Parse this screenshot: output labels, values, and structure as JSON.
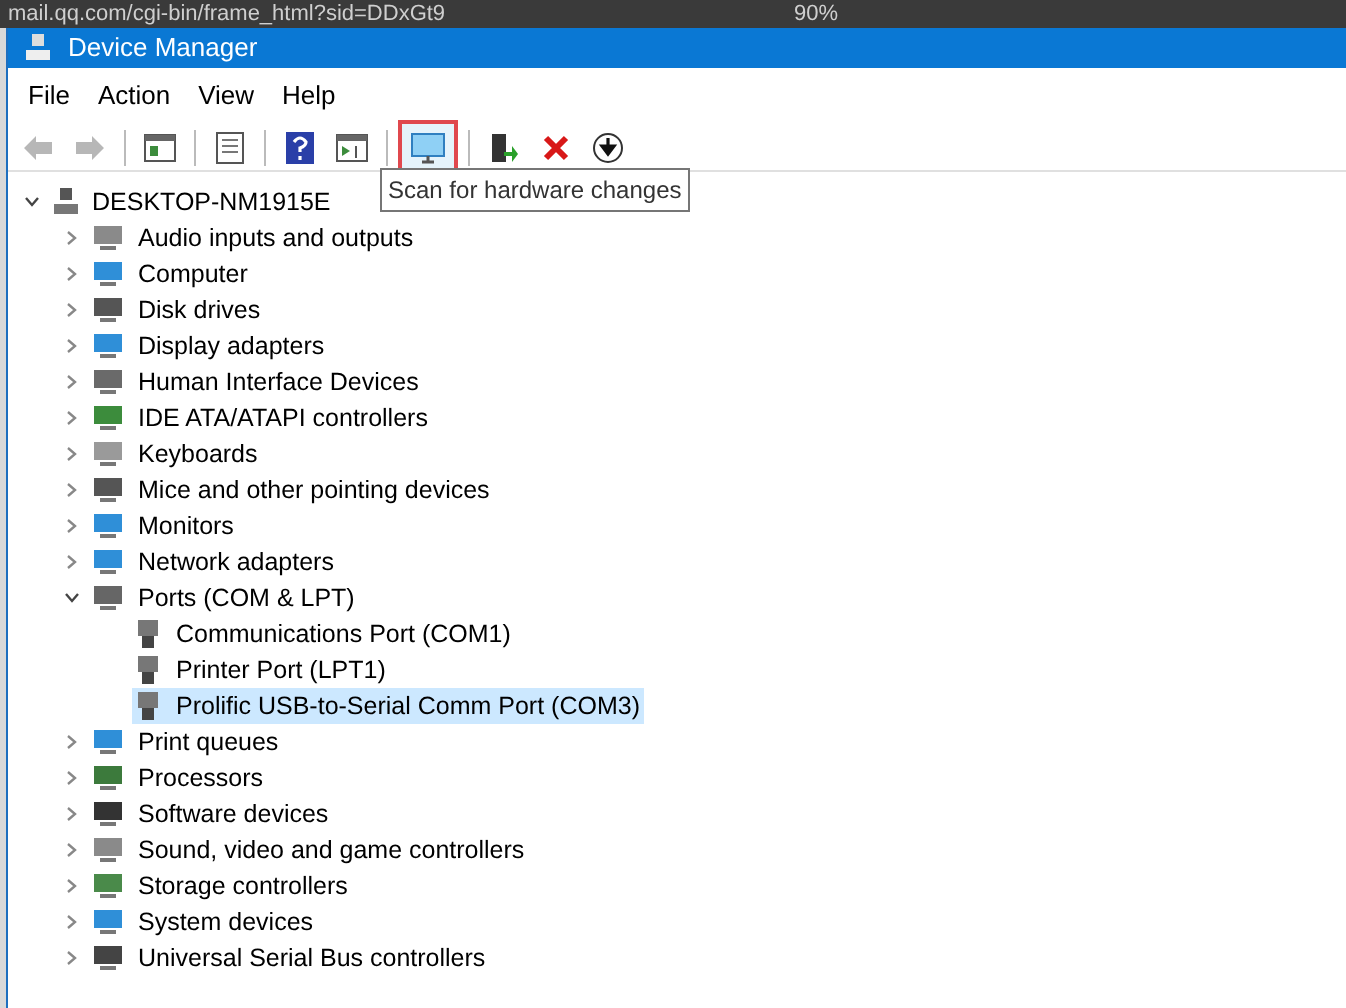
{
  "browser_strip": {
    "url": "mail.qq.com/cgi-bin/frame_html?sid=DDxGt9",
    "zoom": "90%"
  },
  "window": {
    "title": "Device Manager"
  },
  "menu": [
    "File",
    "Action",
    "View",
    "Help"
  ],
  "toolbar": [
    {
      "kind": "back",
      "disabled": true,
      "highlighted": false
    },
    {
      "kind": "forward",
      "disabled": true,
      "highlighted": false
    },
    {
      "kind": "sep"
    },
    {
      "kind": "properties",
      "disabled": false,
      "highlighted": false
    },
    {
      "kind": "sep"
    },
    {
      "kind": "list",
      "disabled": false,
      "highlighted": false
    },
    {
      "kind": "sep"
    },
    {
      "kind": "help",
      "disabled": false,
      "highlighted": false
    },
    {
      "kind": "pane",
      "disabled": false,
      "highlighted": false
    },
    {
      "kind": "sep"
    },
    {
      "kind": "scan",
      "disabled": false,
      "highlighted": true
    },
    {
      "kind": "sep"
    },
    {
      "kind": "update",
      "disabled": false,
      "highlighted": false
    },
    {
      "kind": "uninstall",
      "disabled": false,
      "highlighted": false
    },
    {
      "kind": "download",
      "disabled": false,
      "highlighted": false
    }
  ],
  "tooltip": "Scan for hardware changes",
  "tree": {
    "label": "DESKTOP-NM1915E",
    "expanded": true,
    "children": [
      {
        "label": "Audio inputs and outputs",
        "expanded": false,
        "selected": false
      },
      {
        "label": "Computer",
        "expanded": false,
        "selected": false
      },
      {
        "label": "Disk drives",
        "expanded": false,
        "selected": false
      },
      {
        "label": "Display adapters",
        "expanded": false,
        "selected": false
      },
      {
        "label": "Human Interface Devices",
        "expanded": false,
        "selected": false
      },
      {
        "label": "IDE ATA/ATAPI controllers",
        "expanded": false,
        "selected": false
      },
      {
        "label": "Keyboards",
        "expanded": false,
        "selected": false
      },
      {
        "label": "Mice and other pointing devices",
        "expanded": false,
        "selected": false
      },
      {
        "label": "Monitors",
        "expanded": false,
        "selected": false
      },
      {
        "label": "Network adapters",
        "expanded": false,
        "selected": false
      },
      {
        "label": "Ports (COM & LPT)",
        "expanded": true,
        "selected": false,
        "children": [
          {
            "label": "Communications Port (COM1)",
            "selected": false
          },
          {
            "label": "Printer Port (LPT1)",
            "selected": false
          },
          {
            "label": "Prolific USB-to-Serial Comm Port (COM3)",
            "selected": true
          }
        ]
      },
      {
        "label": "Print queues",
        "expanded": false,
        "selected": false
      },
      {
        "label": "Processors",
        "expanded": false,
        "selected": false
      },
      {
        "label": "Software devices",
        "expanded": false,
        "selected": false
      },
      {
        "label": "Sound, video and game controllers",
        "expanded": false,
        "selected": false
      },
      {
        "label": "Storage controllers",
        "expanded": false,
        "selected": false
      },
      {
        "label": "System devices",
        "expanded": false,
        "selected": false
      },
      {
        "label": "Universal Serial Bus controllers",
        "expanded": false,
        "selected": false
      }
    ]
  }
}
